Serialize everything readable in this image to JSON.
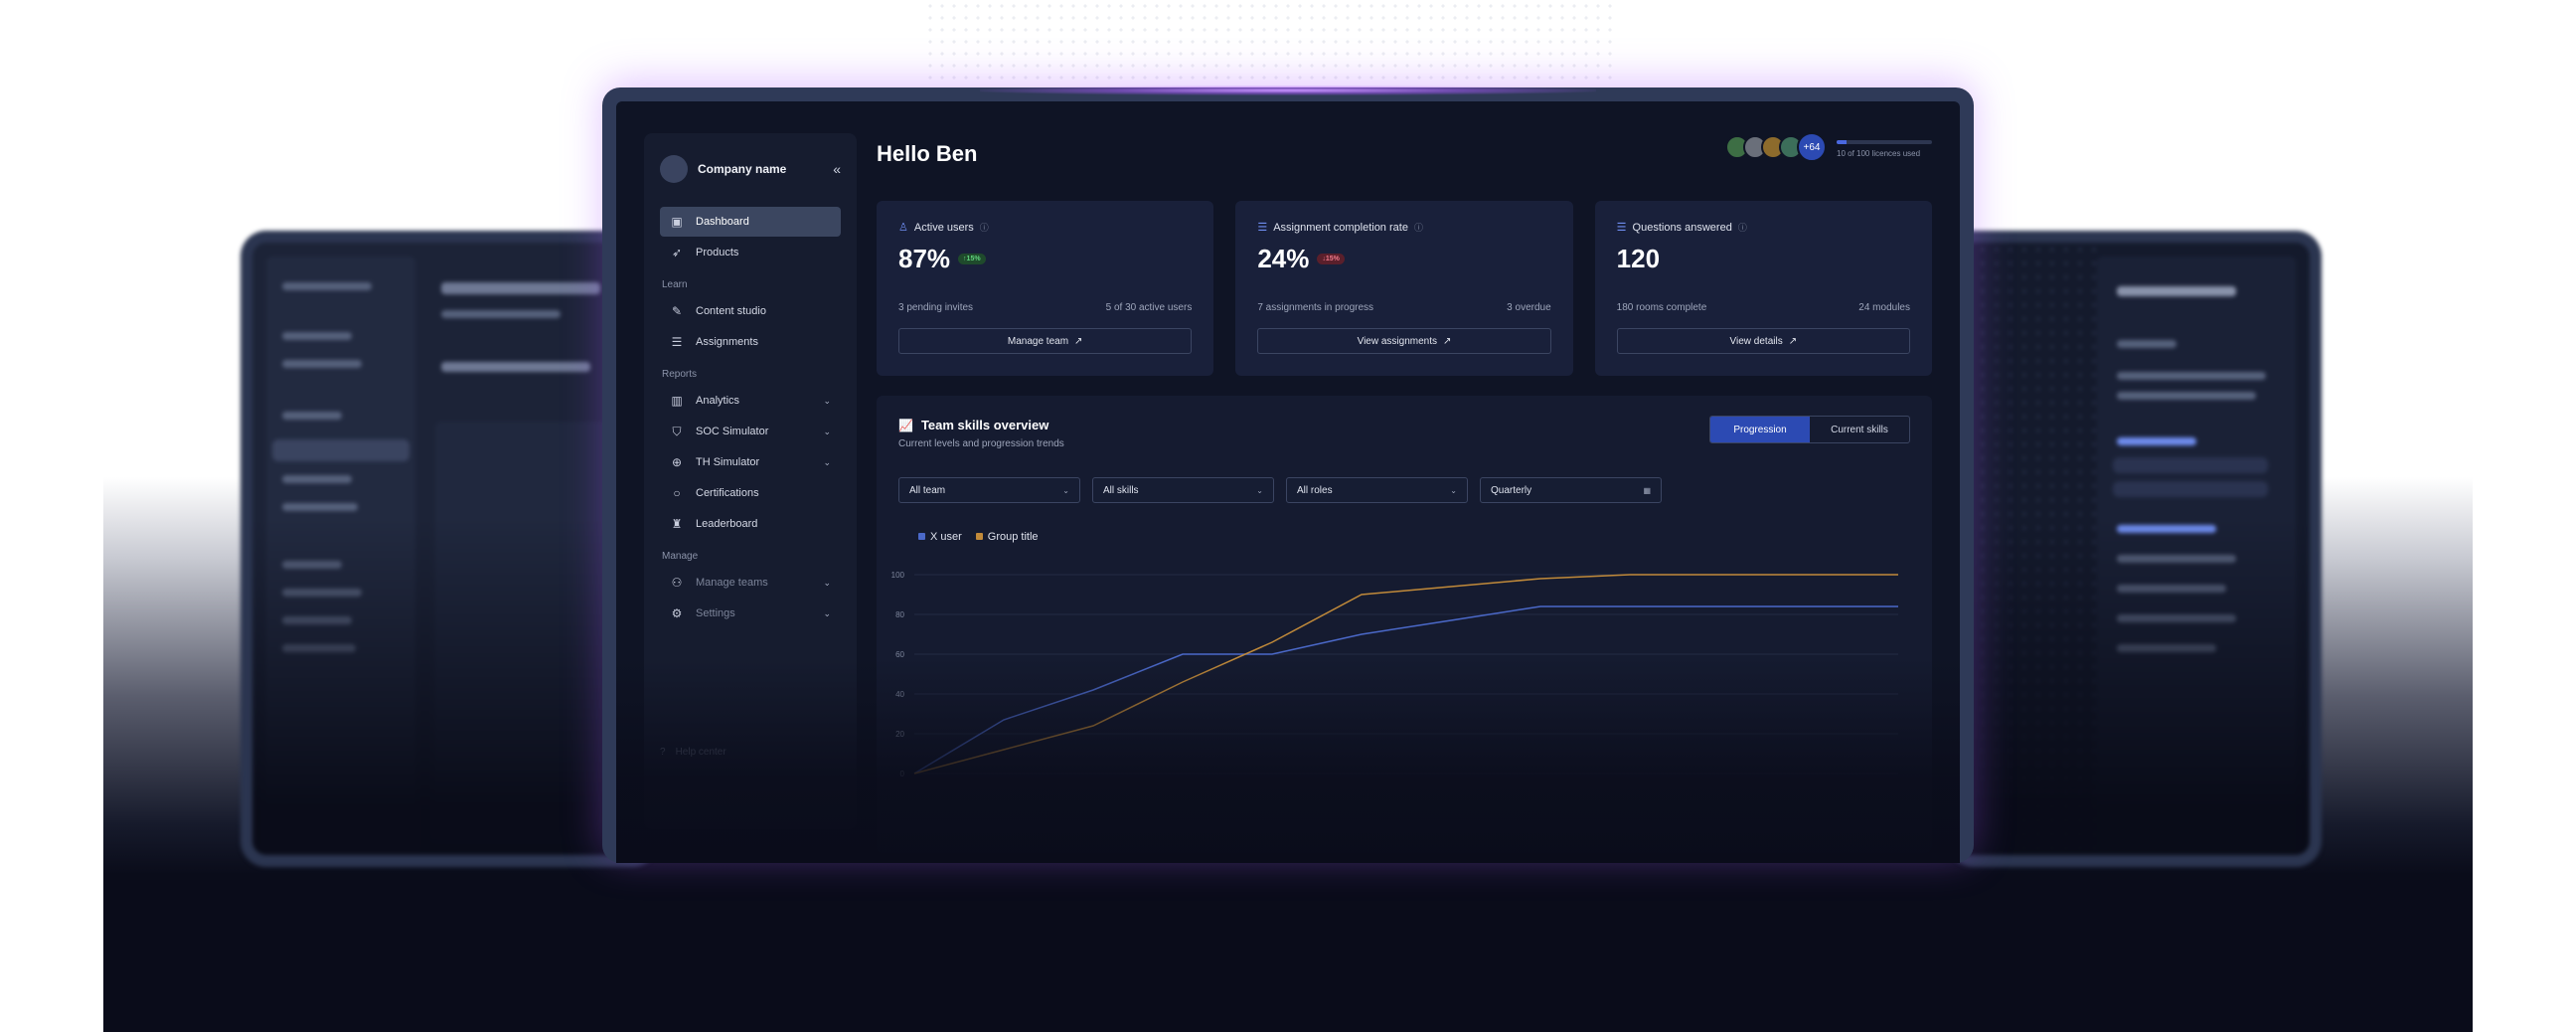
{
  "sidebar": {
    "company_name": "Company name",
    "collapse_icon": "«",
    "items_main": [
      {
        "label": "Dashboard",
        "icon": "dashboard-icon",
        "active": true
      },
      {
        "label": "Products",
        "icon": "rocket-icon"
      }
    ],
    "section_learn": "Learn",
    "items_learn": [
      {
        "label": "Content studio",
        "icon": "edit-icon"
      },
      {
        "label": "Assignments",
        "icon": "list-icon"
      }
    ],
    "section_reports": "Reports",
    "items_reports": [
      {
        "label": "Analytics",
        "icon": "bar-chart-icon",
        "expandable": true
      },
      {
        "label": "SOC Simulator",
        "icon": "shield-icon",
        "expandable": true
      },
      {
        "label": "TH Simulator",
        "icon": "crosshair-icon",
        "expandable": true
      },
      {
        "label": "Certifications",
        "icon": "circle-icon"
      },
      {
        "label": "Leaderboard",
        "icon": "trophy-icon"
      }
    ],
    "section_manage": "Manage",
    "items_manage": [
      {
        "label": "Manage teams",
        "icon": "users-icon",
        "expandable": true
      },
      {
        "label": "Settings",
        "icon": "gear-icon",
        "expandable": true
      }
    ],
    "help_label": "Help center"
  },
  "header": {
    "greeting": "Hello Ben",
    "more_avatars": "+64",
    "licences_text": "10 of 100 licences used",
    "licences_fraction": 0.1
  },
  "cards": [
    {
      "title": "Active users",
      "value": "87%",
      "badge": "↑15%",
      "badge_type": "up",
      "left_note": "3 pending invites",
      "right_note": "5 of 30 active users",
      "button": "Manage team"
    },
    {
      "title": "Assignment completion rate",
      "value": "24%",
      "badge": "↓15%",
      "badge_type": "down",
      "left_note": "7 assignments in progress",
      "right_note": "3 overdue",
      "button": "View assignments"
    },
    {
      "title": "Questions answered",
      "value": "120",
      "badge": "",
      "badge_type": "",
      "left_note": "180 rooms complete",
      "right_note": "24 modules",
      "button": "View details"
    }
  ],
  "skills": {
    "title": "Team skills overview",
    "subtitle": "Current levels and progression trends",
    "toggle": [
      "Progression",
      "Current skills"
    ],
    "filters": [
      "All team",
      "All skills",
      "All roles",
      "Quarterly"
    ]
  },
  "chart_data": {
    "type": "line",
    "ylim": [
      0,
      100
    ],
    "yticks": [
      0,
      20,
      40,
      60,
      80,
      100
    ],
    "x": [
      0,
      1,
      2,
      3,
      4,
      5,
      6,
      7,
      8,
      9,
      10,
      11
    ],
    "series": [
      {
        "name": "X user",
        "color": "#4b69c9",
        "values": [
          0,
          27,
          42,
          60,
          60,
          70,
          77,
          84,
          84,
          84,
          84,
          84
        ]
      },
      {
        "name": "Group title",
        "color": "#c18a3a",
        "values": [
          0,
          12,
          24,
          46,
          66,
          90,
          94,
          98,
          102,
          102,
          102,
          102
        ]
      }
    ]
  },
  "colors": {
    "accent": "#2c4ab3",
    "positive": "#5fd37d",
    "negative": "#f07a8b",
    "glow": "#b06cff"
  }
}
